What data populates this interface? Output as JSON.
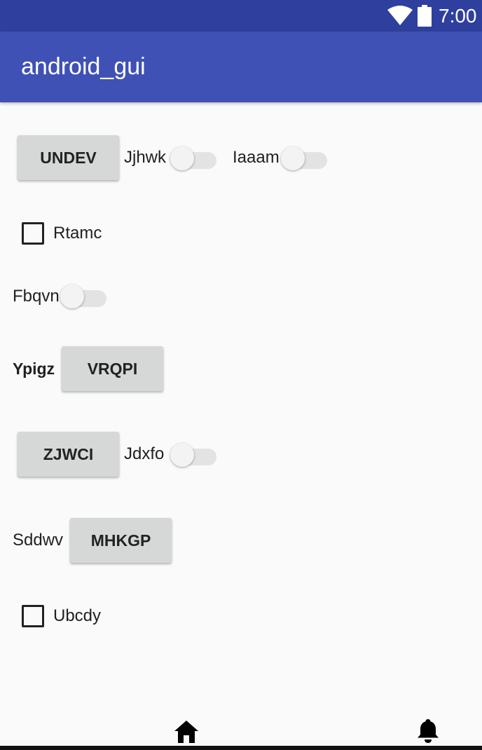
{
  "status_bar": {
    "time": "7:00",
    "icons": [
      "wifi-icon",
      "battery-icon"
    ]
  },
  "app_bar": {
    "title": "android_gui"
  },
  "rows": {
    "r1": {
      "button": "UNDEV",
      "switch1_label": "Jjhwk",
      "switch1_on": false,
      "switch2_label": "Iaaam",
      "switch2_on": false
    },
    "r2": {
      "checkbox_label": "Rtamc",
      "checked": false
    },
    "r3": {
      "switch_label": "Fbqvn",
      "switch_on": false
    },
    "r4": {
      "label": "Ypigz",
      "button": "VRQPI"
    },
    "r5": {
      "button": "ZJWCI",
      "switch_label": "Jdxfo",
      "switch_on": false
    },
    "r6": {
      "label": "Sddwv",
      "button": "MHKGP"
    },
    "r7": {
      "checkbox_label": "Ubcdy",
      "checked": false
    }
  },
  "nav_bar": {
    "icons": [
      "home-icon",
      "bell-icon"
    ]
  },
  "colors": {
    "status_bar": "#2f3f9e",
    "app_bar": "#3f51b5",
    "background": "#fafafa",
    "button": "#d6d7d7"
  }
}
